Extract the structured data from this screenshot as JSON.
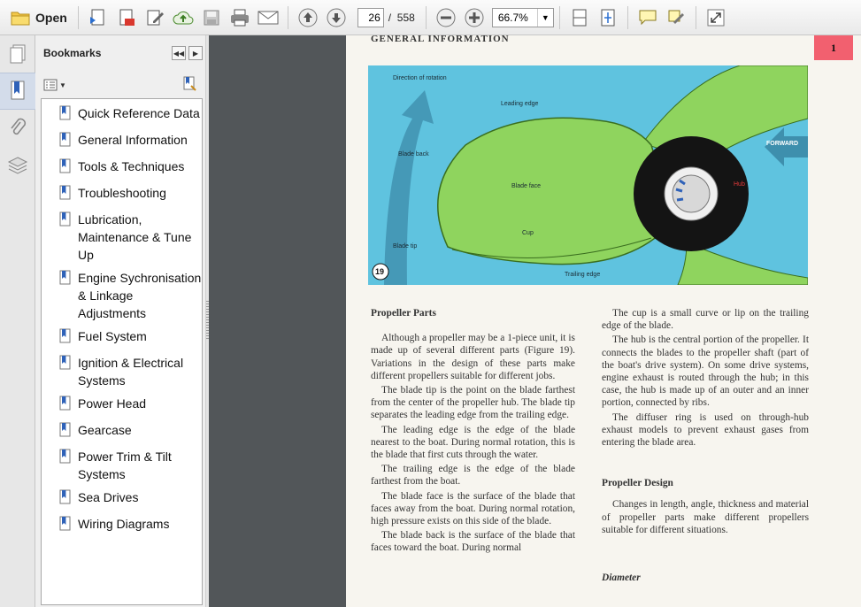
{
  "toolbar": {
    "open_label": "Open",
    "current_page": "26",
    "page_separator": "/",
    "total_pages": "558",
    "zoom": "66.7%"
  },
  "bookmarks": {
    "title": "Bookmarks",
    "items": [
      {
        "label": "Quick Reference Data"
      },
      {
        "label": "General Information"
      },
      {
        "label": "Tools & Techniques"
      },
      {
        "label": "Troubleshooting"
      },
      {
        "label": "Lubrication, Maintenance & Tune Up"
      },
      {
        "label": "Engine Sychronisation & Linkage Adjustments"
      },
      {
        "label": "Fuel System"
      },
      {
        "label": "Ignition & Electrical Systems"
      },
      {
        "label": "Power Head"
      },
      {
        "label": "Gearcase"
      },
      {
        "label": "Power Trim & Tilt Systems"
      },
      {
        "label": "Sea Drives"
      },
      {
        "label": "Wiring Diagrams"
      }
    ]
  },
  "document": {
    "header": "GENERAL INFORMATION",
    "chapter": "1",
    "figure": {
      "number": "19",
      "labels": {
        "direction": "Direction of rotation",
        "leading_edge": "Leading edge",
        "blade_back": "Blade back",
        "blade_face": "Blade face",
        "forward": "FORWARD",
        "hub": "Hub",
        "cup": "Cup",
        "blade_tip": "Blade tip",
        "trailing_edge": "Trailing edge"
      }
    },
    "left_column": {
      "heading": "Propeller Parts",
      "paragraphs": [
        "Although a propeller may be a 1-piece unit, it is made up of several different parts (Figure 19). Variations in the design of these parts make different propellers suitable for different jobs.",
        "The blade tip is the point on the blade farthest from the center of the propeller hub. The blade tip separates the leading edge from the trailing edge.",
        "The leading edge is the edge of the blade nearest to the boat. During normal rotation, this is the blade that first cuts through the water.",
        "The trailing edge is the edge of the blade farthest from the boat.",
        "The blade face is the surface of the blade that faces away from the boat. During normal rotation, high pressure exists on this side of the blade.",
        "The blade back is the surface of the blade that faces toward the boat. During normal"
      ]
    },
    "right_column": {
      "paragraphs": [
        "The cup is a small curve or lip on the trailing edge of the blade.",
        "The hub is the central portion of the propeller. It connects the blades to the propeller shaft (part of the boat's drive system). On some drive systems, engine exhaust is routed through the hub; in this case, the hub is made up of an outer and an inner portion, connected by ribs.",
        "The diffuser ring is used on through-hub exhaust models to prevent exhaust gases from entering the blade area."
      ],
      "heading2": "Propeller Design",
      "paragraph2": "Changes in length, angle, thickness and material of propeller parts make different propellers suitable for different situations.",
      "heading3": "Diameter"
    }
  }
}
